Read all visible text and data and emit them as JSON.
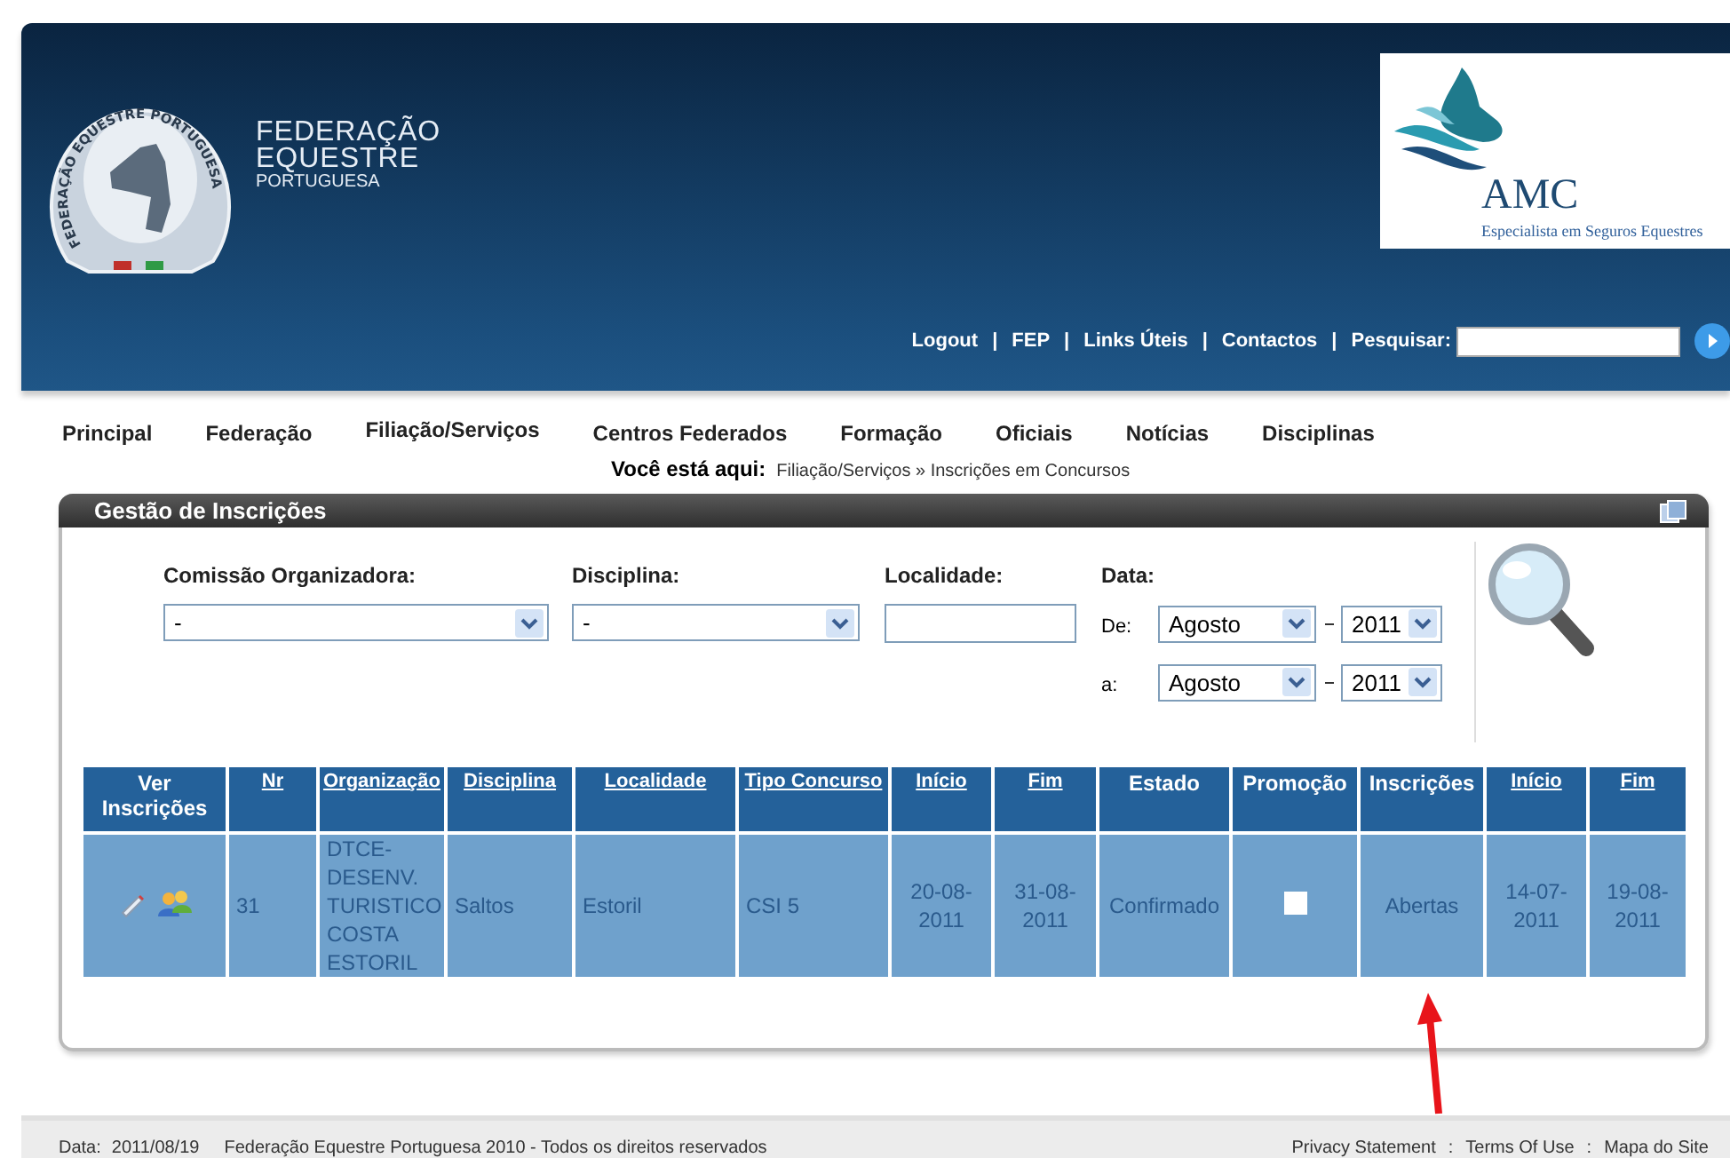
{
  "header": {
    "logo_ring_text": "FEDERAÇÃO EQUESTRE PORTUGUESA",
    "logo_lines": [
      "FEDERAÇÃO",
      "EQUESTRE",
      "PORTUGUESA"
    ],
    "sponsor": {
      "name": "AMC",
      "tagline": "Especialista em Seguros Equestres"
    },
    "top_links": [
      "Logout",
      "FEP",
      "Links Úteis",
      "Contactos"
    ],
    "link_separator": "|",
    "search": {
      "label": "Pesquisar:"
    }
  },
  "nav": [
    "Principal",
    "Federação",
    "Filiação/Serviços",
    "Centros Federados",
    "Formação",
    "Oficiais",
    "Notícias",
    "Disciplinas"
  ],
  "breadcrumb": {
    "label": "Você está aqui:",
    "path": "Filiação/Serviços » Inscrições em Concursos"
  },
  "panel": {
    "title": "Gestão de Inscrições",
    "filters": [
      {
        "kind": "select",
        "label": "Comissão Organizadora:",
        "value": "-"
      },
      {
        "kind": "select",
        "label": "Disciplina:",
        "value": "-"
      },
      {
        "kind": "input",
        "label": "Localidade:"
      }
    ],
    "date": {
      "label": "Data:",
      "ranges": [
        {
          "label": "De:",
          "month": "Agosto",
          "year": "2011"
        },
        {
          "label": "a:",
          "month": "Agosto",
          "year": "2011"
        }
      ]
    },
    "table": {
      "columns": [
        {
          "label": "Ver Inscrições",
          "sortable": false
        },
        {
          "label": "Nr",
          "sortable": true
        },
        {
          "label": "Organização",
          "sortable": true
        },
        {
          "label": "Disciplina",
          "sortable": true
        },
        {
          "label": "Localidade",
          "sortable": true
        },
        {
          "label": "Tipo Concurso",
          "sortable": true
        },
        {
          "label": "Início",
          "sortable": true
        },
        {
          "label": "Fim",
          "sortable": true
        },
        {
          "label": "Estado",
          "sortable": false
        },
        {
          "label": "Promoção",
          "sortable": false
        },
        {
          "label": "Inscrições",
          "sortable": false
        },
        {
          "label": "Início",
          "sortable": true
        },
        {
          "label": "Fim",
          "sortable": true
        }
      ],
      "rows": [
        {
          "nr": "31",
          "organizacao": "DTCE-DESENV. TURISTICO COSTA ESTORIL",
          "disciplina": "Saltos",
          "localidade": "Estoril",
          "tipo": "CSI 5",
          "inicio": "20-08-2011",
          "fim": "31-08-2011",
          "estado": "Confirmado",
          "promocao": false,
          "inscricoes": "Abertas",
          "insc_inicio": "14-07-2011",
          "insc_fim": "19-08-2011"
        }
      ]
    }
  },
  "footer": {
    "date_label": "Data:",
    "date": "2011/08/19",
    "copyright": "Federação Equestre Portuguesa 2010 - Todos os direitos reservados",
    "links": [
      "Privacy Statement",
      "Terms Of Use",
      "Mapa do Site"
    ],
    "link_separator": ":"
  }
}
